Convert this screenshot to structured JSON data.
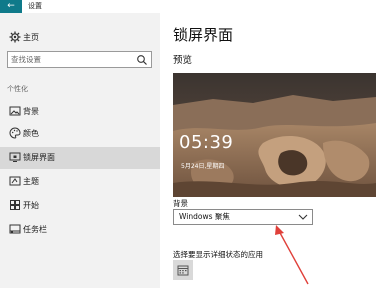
{
  "window": {
    "title": "设置",
    "back_icon": "back-arrow-icon"
  },
  "sidebar": {
    "home_label": "主页",
    "search_placeholder": "查找设置",
    "section_label": "个性化",
    "items": [
      {
        "label": "背景",
        "icon": "image-icon"
      },
      {
        "label": "颜色",
        "icon": "palette-icon"
      },
      {
        "label": "锁屏界面",
        "icon": "lock-screen-icon",
        "active": true
      },
      {
        "label": "主题",
        "icon": "theme-icon"
      },
      {
        "label": "开始",
        "icon": "start-icon"
      },
      {
        "label": "任务栏",
        "icon": "taskbar-icon"
      }
    ]
  },
  "main": {
    "title": "锁屏界面",
    "preview_label": "预览",
    "preview": {
      "time": "05:39",
      "date": "5月24日,星期四"
    },
    "background_label": "背景",
    "background_value": "Windows 聚焦",
    "apps_label": "选择要显示详细状态的应用"
  },
  "colors": {
    "accent": "#0f7a8a",
    "sidebar_bg": "#f2f2f2",
    "active_item": "#d8d8d8",
    "annotation_arrow": "#e0403a"
  }
}
